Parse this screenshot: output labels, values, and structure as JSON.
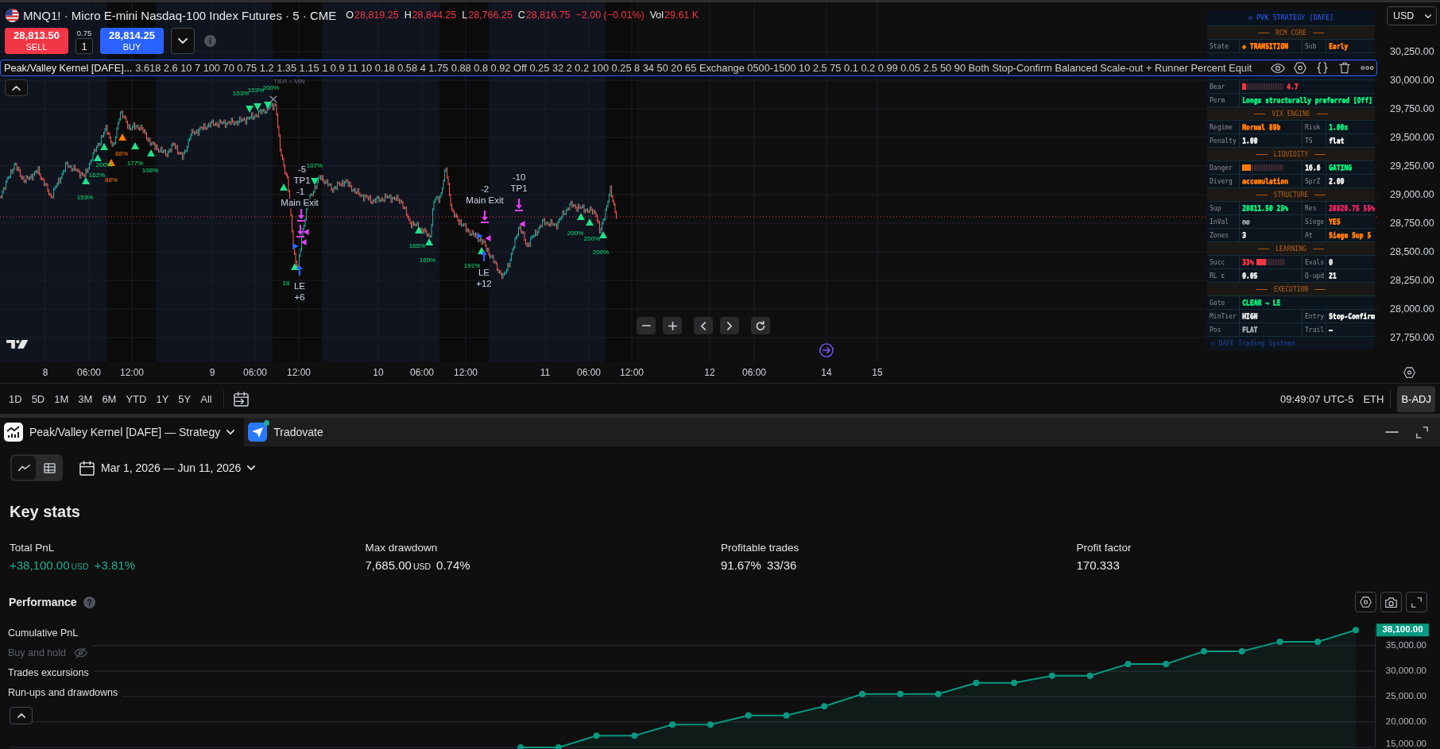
{
  "symbol_header": {
    "title": "MNQ1! · Micro E-mini Nasdaq-100 Index Futures · 5 · CME",
    "ohlc": [
      {
        "label": "O",
        "value": "28,819.25"
      },
      {
        "label": "H",
        "value": "28,844.25"
      },
      {
        "label": "L",
        "value": "28,766.25"
      },
      {
        "label": "C",
        "value": "28,816.75"
      }
    ],
    "change": "−2.00 (−0.01%)",
    "volume": {
      "label": "Vol",
      "value": "29.61 K"
    }
  },
  "order_panel": {
    "sell": {
      "price": "28,813.50",
      "label": "SELL"
    },
    "spread": "0.75",
    "quantity": "1",
    "buy": {
      "price": "28,814.25",
      "label": "BUY"
    }
  },
  "indicator_legend": {
    "name": "Peak/Valley Kernel [DAFE]...",
    "params": "3.618 2.6 10 7 100 70 0.75 1.2 1.35 1.15 1 0.9 11 10 0.18 0.58 4 1.75 0.88 0.8 0.92 Off 0.25 32 2 0.2 100 0.25 8 34 50 20 65 Exchange 0500-1500 10 2.5 75 0.1 0.2 0.99 0.05 2.5 50 90 Both Stop-Confirm Balanced Scale-out + Runner Percent Equit"
  },
  "chart_labels": [
    {
      "text": "153%",
      "kind": "pct"
    },
    {
      "text": "162%",
      "kind": "pct"
    },
    {
      "text": "200%",
      "kind": "pct"
    },
    {
      "text": "88%",
      "kind": "warn"
    },
    {
      "text": "88%",
      "kind": "warn"
    },
    {
      "text": "177%",
      "kind": "pct"
    },
    {
      "text": "108%",
      "kind": "pct"
    },
    {
      "text": "153%",
      "kind": "pct"
    },
    {
      "text": "153%",
      "kind": "pct"
    },
    {
      "text": "200%",
      "kind": "pct"
    },
    {
      "text": "TIER < MIN",
      "kind": "tier"
    },
    {
      "text": "107%",
      "kind": "pct"
    },
    {
      "text": "-5",
      "kind": "trade"
    },
    {
      "text": "TP1",
      "kind": "trade"
    },
    {
      "text": "-1",
      "kind": "trade"
    },
    {
      "text": "Main Exit",
      "kind": "trade"
    },
    {
      "text": "18",
      "kind": "pct"
    },
    {
      "text": "LE",
      "kind": "trade"
    },
    {
      "text": "+6",
      "kind": "trade"
    },
    {
      "text": "165%",
      "kind": "pct"
    },
    {
      "text": "165%",
      "kind": "pct"
    },
    {
      "text": "-2",
      "kind": "trade"
    },
    {
      "text": "Main Exit",
      "kind": "trade"
    },
    {
      "text": "-10",
      "kind": "trade"
    },
    {
      "text": "TP1",
      "kind": "trade"
    },
    {
      "text": "191%",
      "kind": "pct"
    },
    {
      "text": "LE",
      "kind": "trade"
    },
    {
      "text": "+12",
      "kind": "trade"
    },
    {
      "text": "200%",
      "kind": "pct"
    },
    {
      "text": "200%",
      "kind": "pct"
    },
    {
      "text": "200%",
      "kind": "pct"
    }
  ],
  "time_axis": {
    "labels": [
      "8",
      "06:00",
      "12:00",
      "9",
      "06:00",
      "12:00",
      "10",
      "06:00",
      "12:00",
      "11",
      "06:00",
      "12:00",
      "12",
      "06:00",
      "14",
      "15"
    ]
  },
  "price_axis": {
    "currency": "USD",
    "labels": [
      "30,250.00",
      "30,000.00",
      "29,750.00",
      "29,500.00",
      "29,250.00",
      "29,000.00",
      "28,750.00",
      "28,500.00",
      "28,250.00",
      "28,000.00",
      "27,750.00"
    ]
  },
  "strategy_panel": {
    "title": "◇ PVK STRATEGY [DAFE]",
    "sections": [
      {
        "title": "RCM CORE",
        "rows": [
          {
            "cells": [
              {
                "kind": "label",
                "text": "State"
              },
              {
                "kind": "value",
                "text": "◆ TRANSITION",
                "color": "#ff7a00"
              },
              {
                "kind": "label",
                "text": "Sub"
              },
              {
                "kind": "value",
                "text": "Early",
                "color": "#ff7a00"
              }
            ]
          },
          {
            "cells": [
              {
                "kind": "label",
                "text": "Bear"
              },
              {
                "kind": "meter",
                "level": 0.09,
                "color": "#f23645",
                "reading": "4.7"
              }
            ]
          },
          {
            "cells": [
              {
                "kind": "label",
                "text": "Perm"
              },
              {
                "kind": "value",
                "text": "Longs structurally preferred [Off]",
                "color": "#00e676"
              }
            ]
          }
        ]
      },
      {
        "title": "VIX ENGINE",
        "rows": [
          {
            "cells": [
              {
                "kind": "label",
                "text": "Regime"
              },
              {
                "kind": "value",
                "text": "Normal 89b",
                "color": "#ff7a00"
              },
              {
                "kind": "label",
                "text": "Risk"
              },
              {
                "kind": "value",
                "text": "1.00x",
                "color": "#00e676"
              }
            ]
          },
          {
            "cells": [
              {
                "kind": "label",
                "text": "Penalty"
              },
              {
                "kind": "value",
                "text": "1.00",
                "color": "#e6e6e6"
              },
              {
                "kind": "label",
                "text": "TS"
              },
              {
                "kind": "value",
                "text": "flat",
                "color": "#e6e6e6"
              }
            ]
          }
        ]
      },
      {
        "title": "LIQUIDITY",
        "rows": [
          {
            "cells": [
              {
                "kind": "label",
                "text": "Danger"
              },
              {
                "kind": "meter",
                "level": 0.21,
                "color": "#ff7a00"
              },
              {
                "kind": "value",
                "text": "16.6",
                "color": "#e6e6e6"
              },
              {
                "kind": "value",
                "text": "GATING",
                "color": "#00e676"
              }
            ]
          },
          {
            "cells": [
              {
                "kind": "label",
                "text": "Diverg"
              },
              {
                "kind": "value",
                "text": "accumulation",
                "color": "#ff7a00"
              },
              {
                "kind": "label",
                "text": "SprZ"
              },
              {
                "kind": "value",
                "text": "2.09",
                "color": "#e6e6e6"
              }
            ]
          }
        ]
      },
      {
        "title": "STRUCTURE",
        "rows": [
          {
            "cells": [
              {
                "kind": "label",
                "text": "Sup"
              },
              {
                "kind": "value",
                "text": "28811.50 25%",
                "color": "#00e676"
              },
              {
                "kind": "label",
                "text": "Res"
              },
              {
                "kind": "value",
                "text": "28826.75 55%",
                "color": "#e0245e"
              }
            ]
          },
          {
            "cells": [
              {
                "kind": "label",
                "text": "InVal"
              },
              {
                "kind": "value",
                "text": "no",
                "color": "#9aa0a6"
              },
              {
                "kind": "label",
                "text": "Siege"
              },
              {
                "kind": "value",
                "text": "YES",
                "color": "#ff7a00"
              }
            ]
          },
          {
            "cells": [
              {
                "kind": "label",
                "text": "Zones"
              },
              {
                "kind": "value",
                "text": "3",
                "color": "#e6e6e6"
              },
              {
                "kind": "label",
                "text": "At"
              },
              {
                "kind": "value",
                "text": "Siege Sup 5",
                "color": "#ff7a00"
              }
            ]
          }
        ]
      },
      {
        "title": "LEARNING",
        "rows": [
          {
            "cells": [
              {
                "kind": "label",
                "text": "Succ"
              },
              {
                "kind": "reading-meter",
                "level": 0.33,
                "color": "#f23645",
                "reading": "33%"
              },
              {
                "kind": "label",
                "text": "Evals"
              },
              {
                "kind": "value",
                "text": "0",
                "color": "#e6e6e6"
              }
            ]
          },
          {
            "cells": [
              {
                "kind": "label",
                "text": "RL ε"
              },
              {
                "kind": "value",
                "text": "0.05",
                "color": "#e6e6e6"
              },
              {
                "kind": "label",
                "text": "Q-upd"
              },
              {
                "kind": "value",
                "text": "21",
                "color": "#e6e6e6"
              }
            ]
          }
        ]
      },
      {
        "title": "EXECUTION",
        "rows": [
          {
            "cells": [
              {
                "kind": "label",
                "text": "Gate"
              },
              {
                "kind": "value",
                "text": "CLEAR → LE",
                "color": "#00e676"
              }
            ]
          },
          {
            "cells": [
              {
                "kind": "label",
                "text": "MinTier"
              },
              {
                "kind": "value",
                "text": "HIGH",
                "color": "#e6e6e6"
              },
              {
                "kind": "label",
                "text": "Entry"
              },
              {
                "kind": "value",
                "text": "Stop-Confirm",
                "color": "#e6e6e6"
              }
            ]
          },
          {
            "cells": [
              {
                "kind": "label",
                "text": "Pos"
              },
              {
                "kind": "value",
                "text": "FLAT",
                "color": "#9aa0a6"
              },
              {
                "kind": "label",
                "text": "Trail"
              },
              {
                "kind": "value",
                "text": "—",
                "color": "#e6e6e6"
              }
            ]
          }
        ]
      }
    ],
    "footer": "◇ DAFE Trading Systems"
  },
  "range_bar": {
    "ranges": [
      {
        "label": "1D",
        "selected": false
      },
      {
        "label": "5D",
        "selected": false
      },
      {
        "label": "1M",
        "selected": false
      },
      {
        "label": "3M",
        "selected": false
      },
      {
        "label": "6M",
        "selected": false
      },
      {
        "label": "YTD",
        "selected": false
      },
      {
        "label": "1Y",
        "selected": false
      },
      {
        "label": "5Y",
        "selected": false
      },
      {
        "label": "All",
        "selected": false
      }
    ],
    "time": "09:49:07 UTC-5",
    "session": "ETH",
    "adjust": {
      "label": "B-ADJ",
      "on": true
    }
  },
  "bottom_panel": {
    "tabs": [
      {
        "kind": "strategy",
        "label": "Peak/Valley Kernel [DAFE] — Strategy",
        "selected": true,
        "connected": false
      },
      {
        "kind": "broker",
        "label": "Tradovate",
        "selected": false,
        "connected": true
      }
    ],
    "views": [
      {
        "kind": "chart",
        "selected": true
      },
      {
        "kind": "table",
        "selected": false
      }
    ],
    "date_range": "Mar 1, 2026 — Jun 11, 2026",
    "heading": "Key stats",
    "stats": [
      {
        "label": "Total PnL",
        "value": "+38,100.00",
        "unit": "USD",
        "change": "+3.81%",
        "color": "#22ab94"
      },
      {
        "label": "Max drawdown",
        "value": "7,685.00",
        "unit": "USD",
        "change": "0.74%",
        "color": "#e8e8e8"
      },
      {
        "label": "Profitable trades",
        "value": "91.67%",
        "change": "33/36",
        "color": "#e8e8e8"
      },
      {
        "label": "Profit factor",
        "value": "170.333",
        "color": "#e8e8e8"
      }
    ],
    "performance": {
      "title": "Performance",
      "series": [
        {
          "label": "Cumulative PnL",
          "hidden": false
        },
        {
          "label": "Buy and hold",
          "hidden": true
        },
        {
          "label": "Trades excursions",
          "hidden": false
        },
        {
          "label": "Run-ups and drawdowns",
          "hidden": false
        }
      ],
      "chart_data": [
        {
          "type": "area",
          "categories": [
            null,
            null,
            null,
            null,
            null,
            null,
            null,
            null,
            null,
            null,
            null,
            null,
            null,
            null,
            null,
            null,
            null,
            null,
            null,
            null,
            null,
            null,
            null
          ],
          "values": [
            15000,
            15000,
            17300,
            17300,
            19500,
            19500,
            21300,
            21300,
            23100,
            25500,
            25500,
            25500,
            27700,
            27700,
            29100,
            29100,
            31400,
            31400,
            33900,
            33900,
            35800,
            35800,
            38100
          ],
          "color": "#089981",
          "marker": "circle",
          "grid": true,
          "tick_labels": "y",
          "ylim": [
            15000,
            39000
          ],
          "yticks": [
            {
              "value": 35000,
              "label": "35,000.00"
            },
            {
              "value": 30000,
              "label": "30,000.00"
            },
            {
              "value": 25000,
              "label": "25,000.00"
            },
            {
              "value": 20000,
              "label": "20,000.00"
            },
            {
              "value": 15000,
              "label": "15,000.00"
            }
          ],
          "annotations": [
            "38,100.00"
          ]
        }
      ]
    }
  }
}
